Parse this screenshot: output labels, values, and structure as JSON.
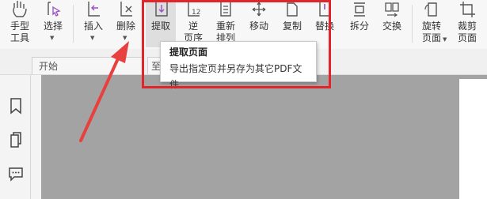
{
  "ribbon": {
    "buttons": [
      {
        "id": "hand",
        "label": "手型",
        "label2": "工具",
        "icon": "hand-icon"
      },
      {
        "id": "select",
        "label": "选择",
        "icon": "select-cursor-icon"
      },
      {
        "id": "insert",
        "label": "插入",
        "icon": "insert-page-icon"
      },
      {
        "id": "delete",
        "label": "删除",
        "icon": "delete-page-icon"
      },
      {
        "id": "extract",
        "label": "提取",
        "icon": "extract-page-icon"
      },
      {
        "id": "reverse",
        "label": "逆",
        "label2": "页序",
        "icon": "reverse-order-icon"
      },
      {
        "id": "rearrange",
        "label": "重新",
        "label2": "排列",
        "icon": "rearrange-icon"
      },
      {
        "id": "move",
        "label": "移动",
        "icon": "move-icon"
      },
      {
        "id": "copy",
        "label": "复制",
        "icon": "copy-icon"
      },
      {
        "id": "replace",
        "label": "替换",
        "icon": "replace-icon"
      },
      {
        "id": "split",
        "label": "拆分",
        "icon": "split-icon"
      },
      {
        "id": "swap",
        "label": "交换",
        "icon": "swap-icon"
      },
      {
        "id": "rotate",
        "label": "旋转",
        "label2": "页面",
        "icon": "rotate-page-icon"
      },
      {
        "id": "crop",
        "label": "裁剪",
        "label2": "页面",
        "icon": "crop-page-icon"
      }
    ]
  },
  "tabs": [
    {
      "label": "开始"
    },
    {
      "label": "至"
    }
  ],
  "tooltip": {
    "title": "提取页面",
    "description": "导出指定页并另存为其它PDF文件"
  },
  "sidebar": {
    "icons": [
      "bookmark-icon",
      "pages-icon",
      "comment-icon"
    ]
  },
  "colors": {
    "highlight_box": "#e0262b",
    "arrow": "#e8403f",
    "viewer_bg": "#a3a3a3",
    "accent_purple": "#9b4fc2"
  }
}
